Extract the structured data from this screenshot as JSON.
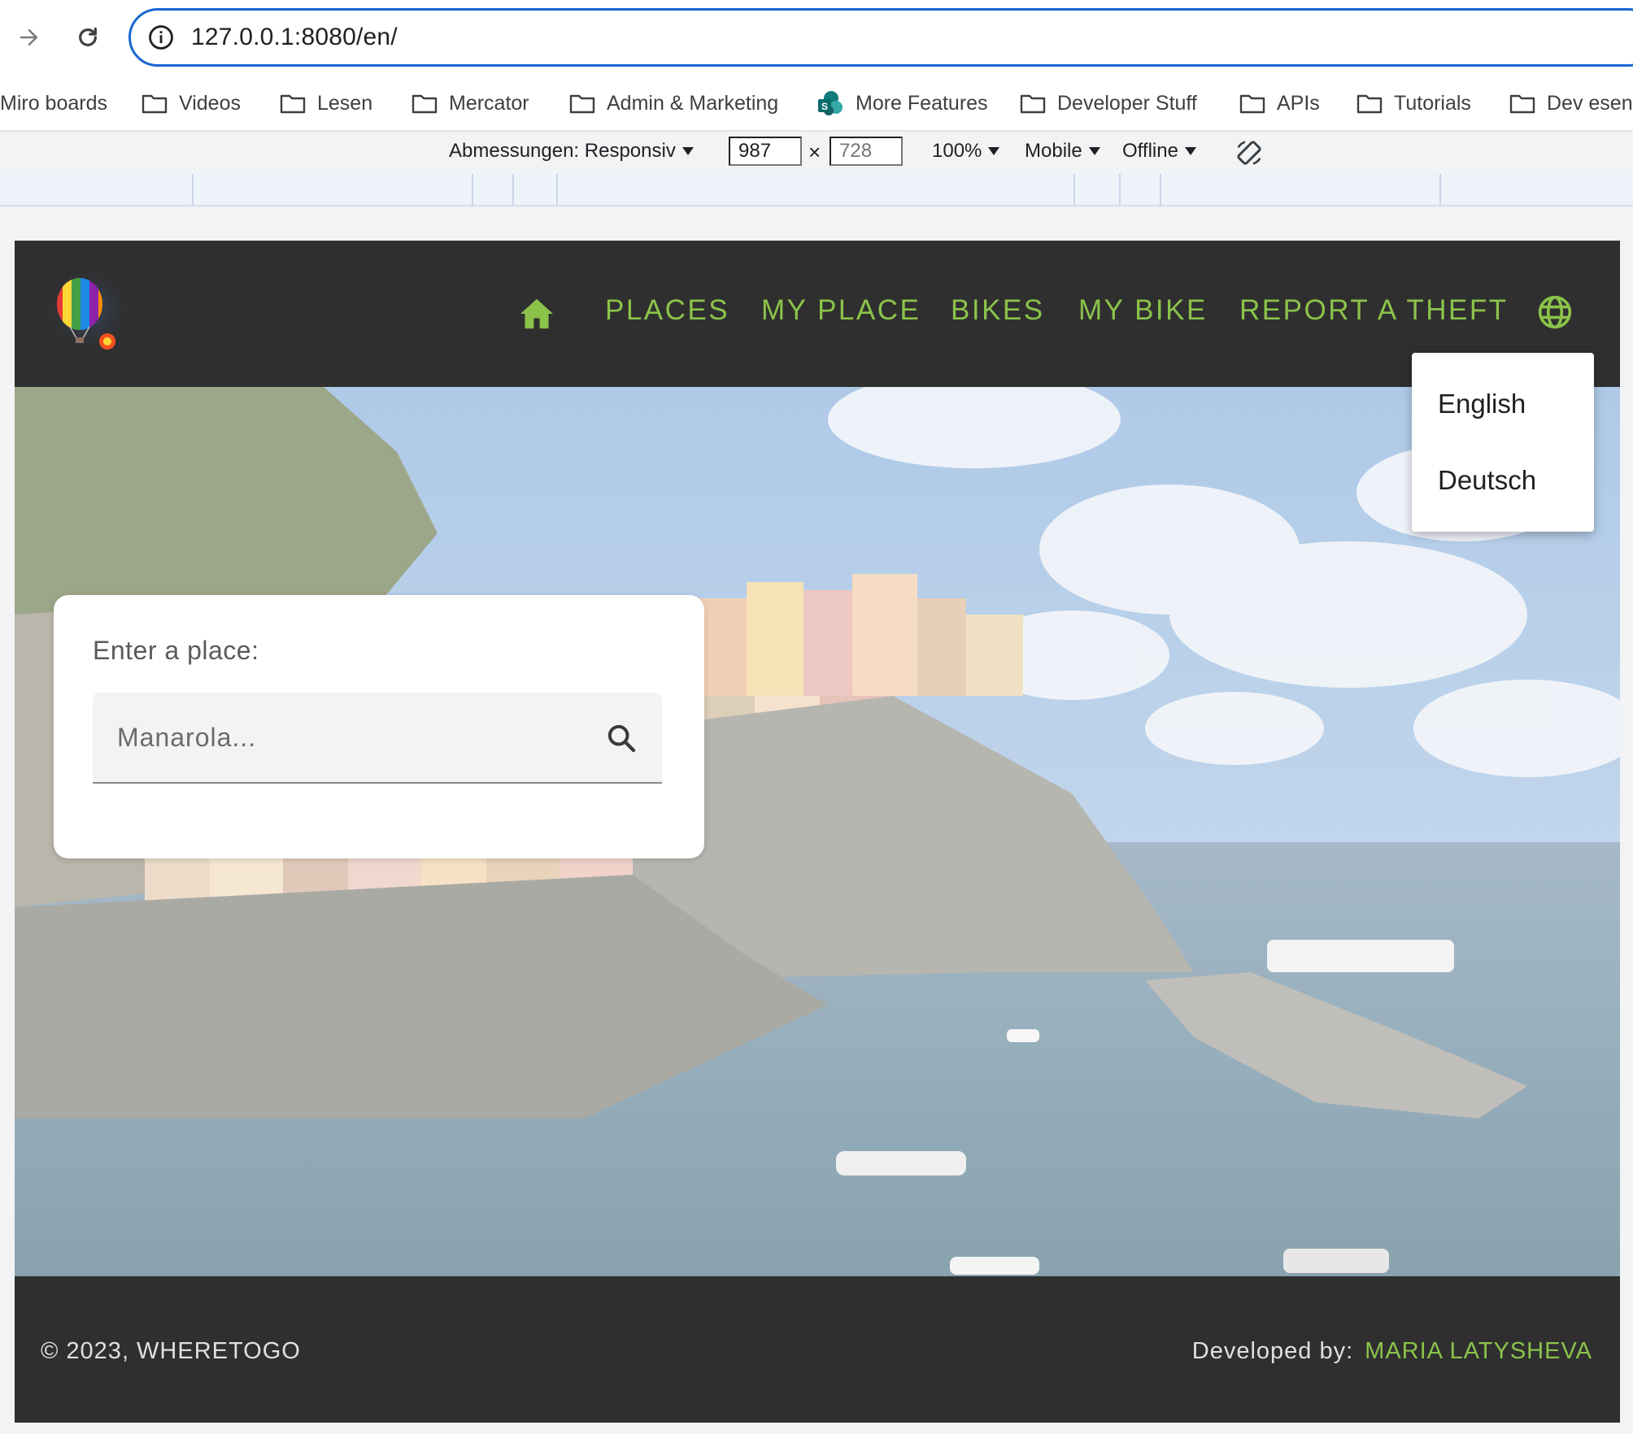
{
  "browser": {
    "url": "127.0.0.1:8080/en/",
    "bookmarks": [
      {
        "label": "Miro boards",
        "icon": "miro-icon"
      },
      {
        "label": "Videos",
        "icon": "folder-icon"
      },
      {
        "label": "Lesen",
        "icon": "folder-icon"
      },
      {
        "label": "Mercator",
        "icon": "folder-icon"
      },
      {
        "label": "Admin & Marketing",
        "icon": "folder-icon"
      },
      {
        "label": "More Features",
        "icon": "sharepoint-icon"
      },
      {
        "label": "Developer Stuff",
        "icon": "folder-icon"
      },
      {
        "label": "APIs",
        "icon": "folder-icon"
      },
      {
        "label": "Tutorials",
        "icon": "folder-icon"
      },
      {
        "label": "Dev esen",
        "icon": "folder-icon"
      }
    ]
  },
  "devtools": {
    "dimensions_label": "Abmessungen: Responsiv",
    "width_value": "987",
    "height_value": "728",
    "zoom": "100%",
    "device_type": "Mobile",
    "network": "Offline"
  },
  "site": {
    "nav": {
      "home_icon": "home-icon",
      "links": [
        "PLACES",
        "MY PLACE",
        "BIKES",
        "MY BIKE",
        "REPORT A THEFT"
      ],
      "language_icon": "globe-icon",
      "accent_color": "#8bc34a"
    },
    "search": {
      "label": "Enter a place:",
      "placeholder": "Manarola...",
      "icon": "search-icon"
    },
    "language_menu": {
      "options": [
        "English",
        "Deutsch"
      ]
    },
    "footer": {
      "copyright": "© 2023, WHERETOGO",
      "developed_by_label": "Developed by:",
      "developer_name": "MARIA LATYSHEVA"
    }
  }
}
